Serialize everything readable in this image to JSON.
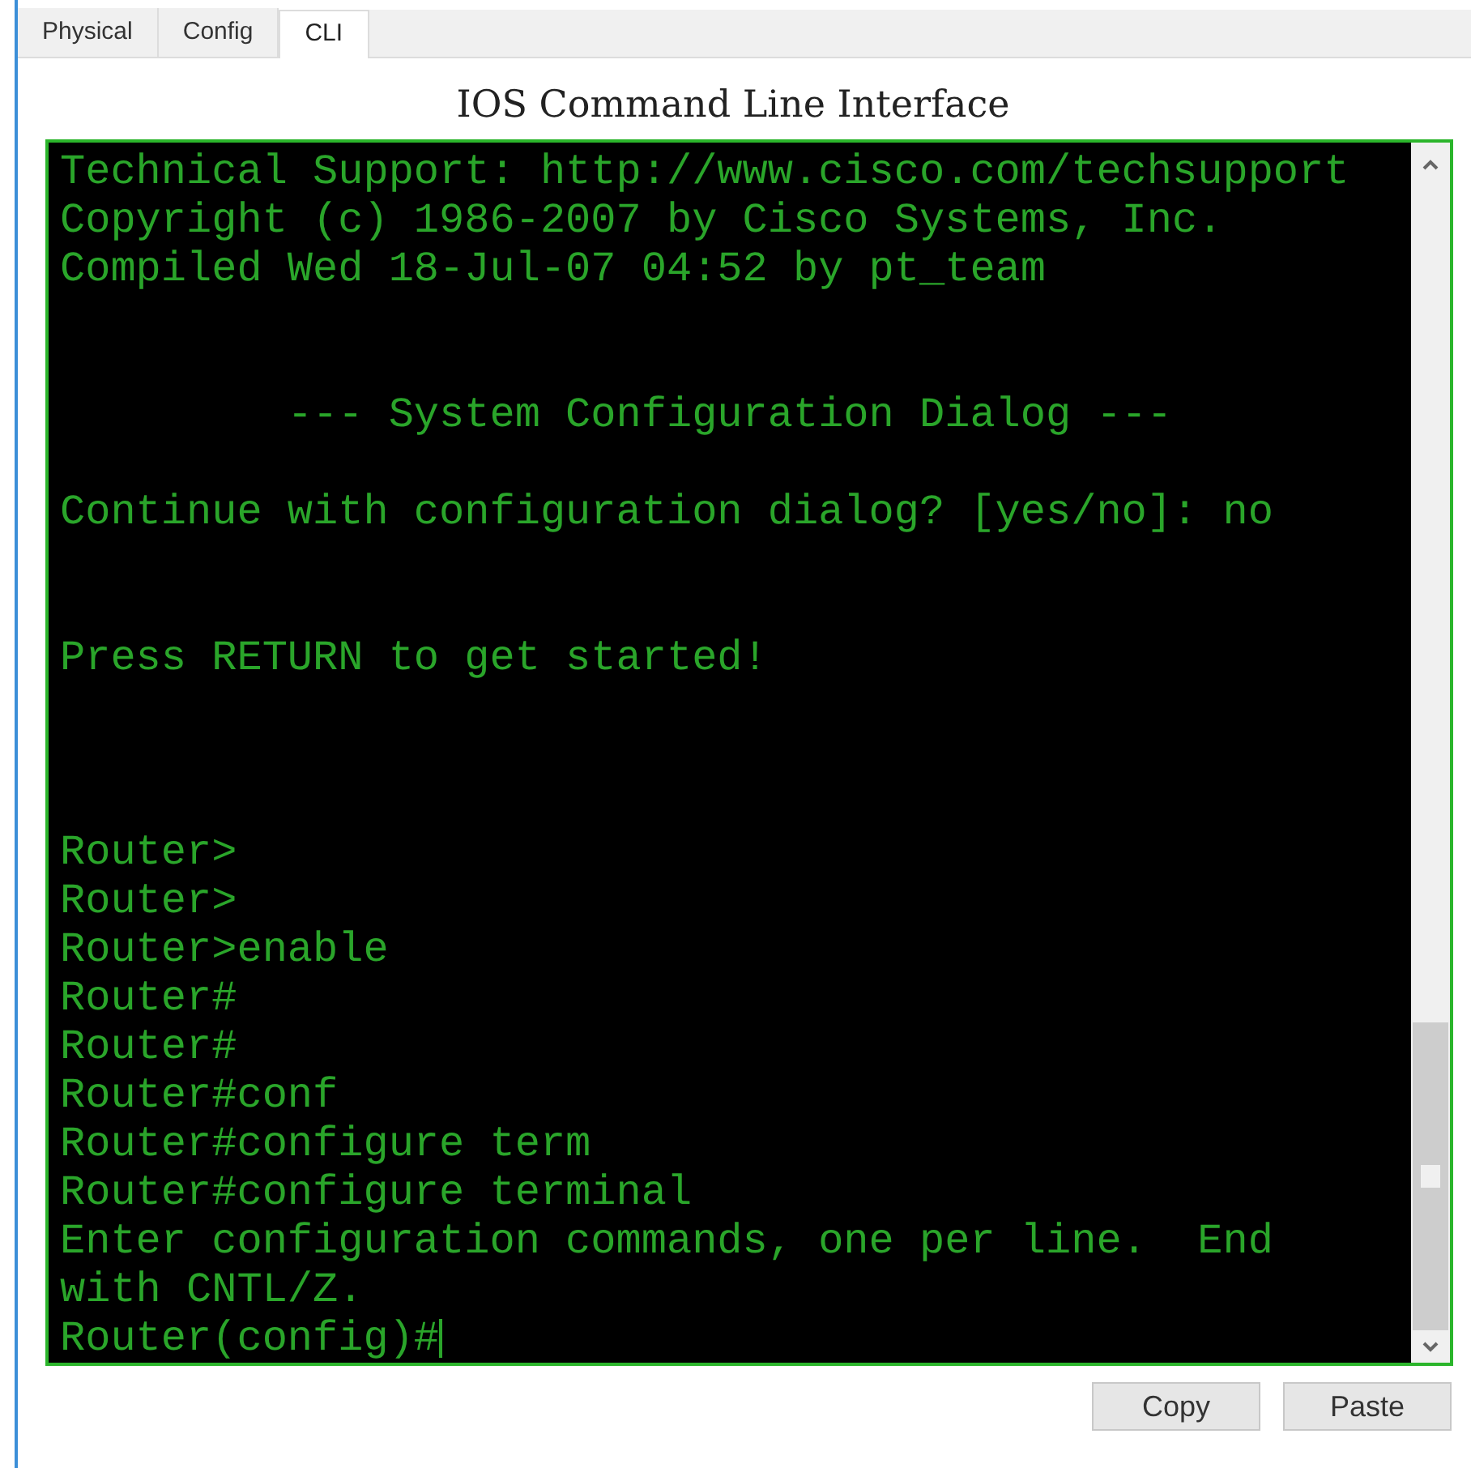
{
  "tabs": [
    {
      "label": "Physical",
      "selected": false
    },
    {
      "label": "Config",
      "selected": false
    },
    {
      "label": "CLI",
      "selected": true
    }
  ],
  "title": "IOS Command Line Interface",
  "terminal": {
    "lines": [
      {
        "kind": "text",
        "text": "Technical Support: http://www.cisco.com/techsupport"
      },
      {
        "kind": "text",
        "text": "Copyright (c) 1986-2007 by Cisco Systems, Inc."
      },
      {
        "kind": "text",
        "text": "Compiled Wed 18-Jul-07 04:52 by pt_team"
      },
      {
        "kind": "blank"
      },
      {
        "kind": "blank"
      },
      {
        "kind": "text",
        "text": "         --- System Configuration Dialog ---"
      },
      {
        "kind": "blank"
      },
      {
        "kind": "text",
        "text": "Continue with configuration dialog? [yes/no]: no"
      },
      {
        "kind": "blank"
      },
      {
        "kind": "blank"
      },
      {
        "kind": "text",
        "text": "Press RETURN to get started!"
      },
      {
        "kind": "blank"
      },
      {
        "kind": "blank"
      },
      {
        "kind": "blank"
      },
      {
        "kind": "text",
        "text": "Router>"
      },
      {
        "kind": "text",
        "text": "Router>"
      },
      {
        "kind": "text",
        "text": "Router>enable"
      },
      {
        "kind": "text",
        "text": "Router#"
      },
      {
        "kind": "text",
        "text": "Router#"
      },
      {
        "kind": "text",
        "text": "Router#conf"
      },
      {
        "kind": "text",
        "text": "Router#configure term"
      },
      {
        "kind": "text",
        "text": "Router#configure terminal"
      },
      {
        "kind": "text",
        "text": "Enter configuration commands, one per line.  End"
      },
      {
        "kind": "text",
        "text": "with CNTL/Z."
      },
      {
        "kind": "prompt",
        "text": "Router(config)#"
      }
    ]
  },
  "buttons": [
    "Copy",
    "Paste"
  ]
}
